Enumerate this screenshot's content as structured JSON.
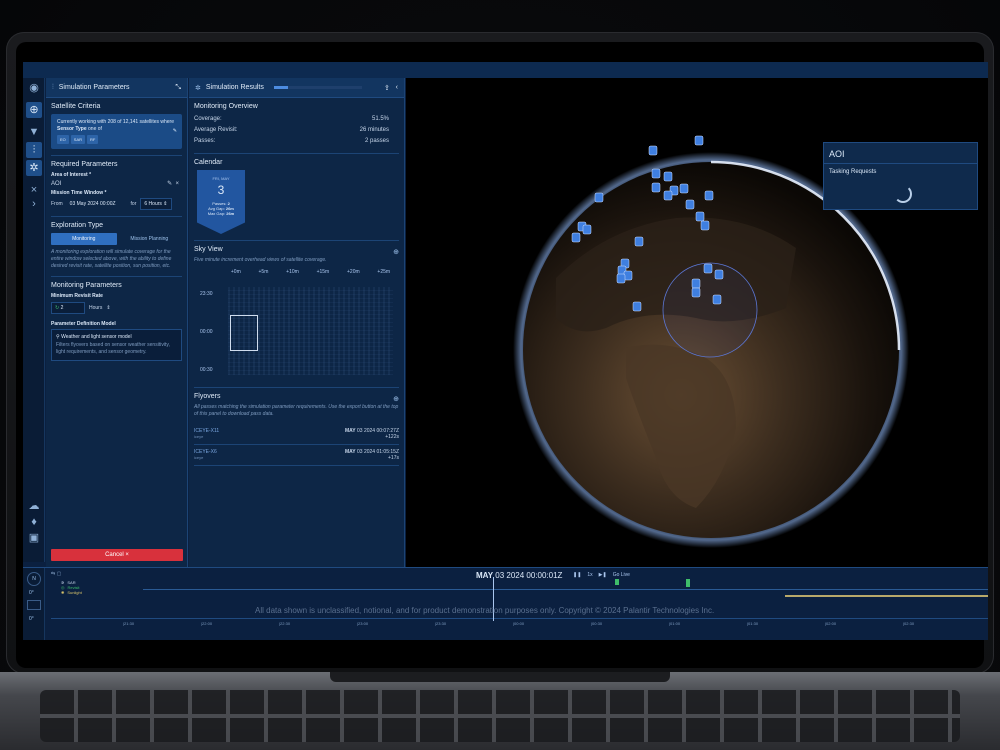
{
  "params": {
    "title": "Simulation Parameters",
    "satellite_criteria": "Satellite Criteria",
    "info_pre": "Currently working with 208 of 12,141 satellites where ",
    "info_bold": "Sensor Type",
    "info_post": " one of",
    "chips": [
      "EO",
      "SAR",
      "RF"
    ],
    "required": "Required Parameters",
    "aoi_label": "Area of Interest *",
    "aoi_value": "AOI",
    "mtw_label": "Mission Time Window *",
    "from_label": "From",
    "from_value": "03 May 2024 00:00Z",
    "for_label": "for",
    "for_value": "6 Hours",
    "exploration": "Exploration Type",
    "seg_monitoring": "Monitoring",
    "seg_planning": "Mission Planning",
    "exploration_desc": "A monitoring exploration will simulate coverage for the entire window selected above, with the ability to define desired revisit rate, satellite position, sun position, etc.",
    "monitoring": "Monitoring Parameters",
    "min_revisit": "Minimum Revisit Rate",
    "revisit_value": "2",
    "revisit_unit": "Hours",
    "pdm": "Parameter Definition Model",
    "model_title": "Weather and light sensor model",
    "model_desc": "Filters flyovers based on sensor weather sensitivity, light requirements, and sensor geometry.",
    "cancel": "Cancel"
  },
  "results": {
    "title": "Simulation Results",
    "overview": "Monitoring Overview",
    "coverage_label": "Coverage:",
    "coverage_value": "51.5%",
    "revisit_label": "Average Revisit:",
    "revisit_value": "26 minutes",
    "passes_label": "Passes:",
    "passes_value": "2 passes",
    "calendar": "Calendar",
    "cal_day": "FRI, MAY",
    "cal_num": "3",
    "cal_passes": "Passes:",
    "cal_passes_v": "2",
    "cal_avg": "Avg Gap:",
    "cal_avg_v": "26m",
    "cal_max": "Max Gap:",
    "cal_max_v": "26m",
    "sky": "Sky View",
    "sky_desc": "Five minute increment overhead views of satellite coverage.",
    "sky_cols": [
      "+0m",
      "+5m",
      "+10m",
      "+15m",
      "+20m",
      "+25m"
    ],
    "sky_rows": [
      "23:30",
      "00:00",
      "00:30"
    ],
    "flyovers": "Flyovers",
    "fly_desc": "All passes matching the simulation parameter requirements. Use the export button at the top of this panel to download pass data.",
    "fly_items": [
      {
        "name": "ICEYE-X11",
        "type": "iceye",
        "date_bold": "MAY",
        "date": " 03 2024 00:07:27Z",
        "delta": "+122s"
      },
      {
        "name": "ICEYE-X6",
        "type": "iceye",
        "date_bold": "MAY",
        "date": " 03 2024 01:05:15Z",
        "delta": "+17s"
      }
    ]
  },
  "aoi_card": {
    "title": "AOI",
    "subtitle": "Tasking Requests"
  },
  "timeline": {
    "clock_bold": "MAY",
    "clock": " 03 2024 00:00:01Z",
    "speed": "1x",
    "golive": "Go Live",
    "legend": [
      "SAR",
      "Revisit",
      "Sunlight"
    ],
    "rail_values": [
      "0°",
      "0°"
    ],
    "ticks": [
      "21:30",
      "22:00",
      "22:30",
      "23:00",
      "23:30",
      "00:00",
      "00:30",
      "01:00",
      "01:30",
      "02:00",
      "02:30"
    ],
    "disclaimer": "All data shown is unclassified, notional, and for product demonstration purposes only. Copyright © 2024 Palantir Technologies Inc."
  },
  "colors": {
    "accent": "#2f6fc0",
    "cancel": "#d8313c",
    "sunlight": "#b9a96a",
    "revisit": "#3fbd6a"
  }
}
